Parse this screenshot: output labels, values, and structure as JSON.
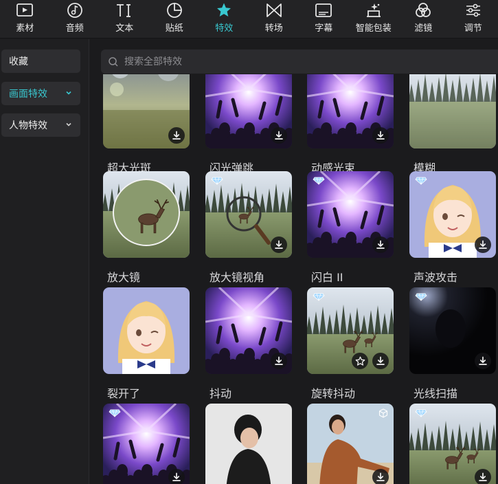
{
  "toolbar": {
    "items": [
      {
        "label": "素材",
        "icon": "media-icon",
        "active": false
      },
      {
        "label": "音频",
        "icon": "audio-icon",
        "active": false
      },
      {
        "label": "文本",
        "icon": "text-icon",
        "active": false
      },
      {
        "label": "贴纸",
        "icon": "sticker-icon",
        "active": false
      },
      {
        "label": "特效",
        "icon": "effects-star-icon",
        "active": true
      },
      {
        "label": "转场",
        "icon": "transition-icon",
        "active": false
      },
      {
        "label": "字幕",
        "icon": "subtitle-icon",
        "active": false
      },
      {
        "label": "智能包装",
        "icon": "smart-package-icon",
        "active": false
      },
      {
        "label": "滤镜",
        "icon": "filter-icon",
        "active": false
      },
      {
        "label": "调节",
        "icon": "adjust-icon",
        "active": false
      }
    ],
    "accent": "#39c8d0"
  },
  "sidebar": {
    "items": [
      {
        "label": "收藏",
        "active": false,
        "has_chevron": false
      },
      {
        "label": "画面特效",
        "active": true,
        "has_chevron": true
      },
      {
        "label": "人物特效",
        "active": false,
        "has_chevron": true
      }
    ]
  },
  "search": {
    "placeholder": "搜索全部特效"
  },
  "effects": [
    {
      "name": "超大光斑",
      "thumb": "bokeh",
      "download": true
    },
    {
      "name": "闪光弹跳",
      "thumb": "concert",
      "download": true
    },
    {
      "name": "动感光束",
      "thumb": "concert",
      "download": true
    },
    {
      "name": "模糊",
      "thumb": "forest-blur",
      "download": false
    },
    {
      "name": "放大镜",
      "thumb": "deer-circle",
      "download": false
    },
    {
      "name": "放大镜视角",
      "thumb": "deer-magnifier",
      "download": true,
      "premium": true
    },
    {
      "name": "闪白 II",
      "thumb": "concert",
      "download": true,
      "premium": true
    },
    {
      "name": "声波攻击",
      "thumb": "anime-girl",
      "download": true,
      "premium": true
    },
    {
      "name": "裂开了",
      "thumb": "anime-girl",
      "download": false
    },
    {
      "name": "抖动",
      "thumb": "concert",
      "download": true
    },
    {
      "name": "旋转抖动",
      "thumb": "forest-deer",
      "download": true,
      "favorite": true,
      "premium": true
    },
    {
      "name": "光线扫描",
      "thumb": "dark",
      "download": true,
      "premium": true
    },
    {
      "name": "",
      "thumb": "concert",
      "download": true,
      "premium": true
    },
    {
      "name": "",
      "thumb": "man-hoodie",
      "download": false
    },
    {
      "name": "",
      "thumb": "woman-sweater",
      "download": true,
      "cube": true
    },
    {
      "name": "",
      "thumb": "forest-deer",
      "download": true,
      "premium": true
    }
  ]
}
